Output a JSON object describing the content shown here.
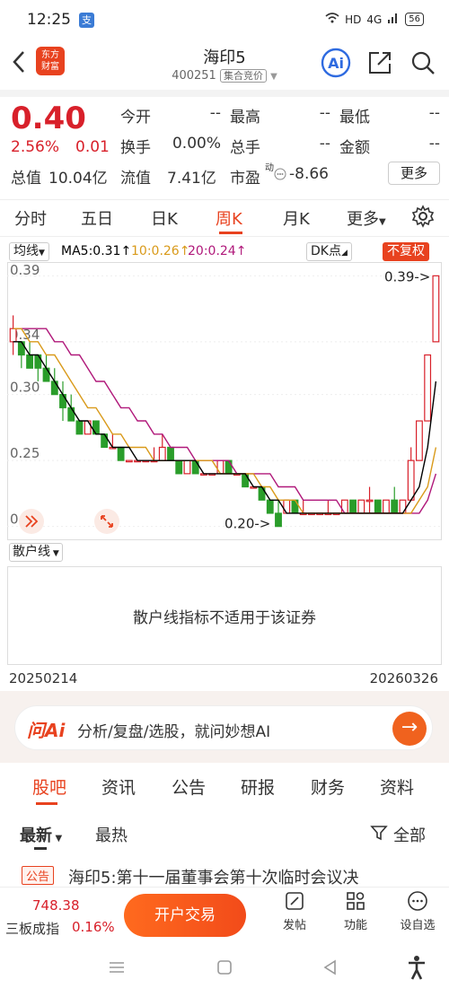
{
  "status": {
    "time": "12:25",
    "app_badge": "支",
    "network": "HD",
    "signal": "4G",
    "battery": "56"
  },
  "header": {
    "logo_text": "东方\n财富",
    "title": "海印5",
    "code": "400251",
    "market_tag": "集合竞价"
  },
  "quote": {
    "price": "0.40",
    "pct": "2.56%",
    "chg": "0.01",
    "fields": [
      {
        "label": "今开",
        "value": "--"
      },
      {
        "label": "最高",
        "value": "--"
      },
      {
        "label": "最低",
        "value": "--"
      },
      {
        "label": "换手",
        "value": "0.00%"
      },
      {
        "label": "总手",
        "value": "--"
      },
      {
        "label": "金额",
        "value": "--"
      }
    ],
    "total_label": "总值",
    "total_value": "10.04亿",
    "float_label": "流值",
    "float_value": "7.41亿",
    "pe_label": "市盈",
    "pe_sup": "动",
    "pe_value": "-8.66",
    "more_label": "更多"
  },
  "tabs": [
    "分时",
    "五日",
    "日K",
    "周K",
    "月K",
    "更多"
  ],
  "active_tab": "周K",
  "ma": {
    "type_label": "均线",
    "ma5": "MA5:0.31↑",
    "ma10": "10:0.26↑",
    "ma20": "20:0.24↑",
    "dk_label": "DK点",
    "adj_label": "不复权"
  },
  "colors": {
    "accent": "#e8421f",
    "up": "#d8202a",
    "down": "#2a9d2a",
    "ma5": "#000000",
    "ma10": "#d99a1a",
    "ma20": "#b0187a"
  },
  "chart_data": {
    "type": "candlestick",
    "y_ticks": [
      "0.39",
      "0.34",
      "0.30",
      "0.25",
      "0.20"
    ],
    "ylim": [
      0.195,
      0.395
    ],
    "max_label": "0.39->",
    "min_label": "0.20->",
    "start_date": "20250214",
    "end_date": "20260326",
    "candles": [
      [
        0.34,
        0.36,
        0.33,
        0.35
      ],
      [
        0.34,
        0.34,
        0.32,
        0.33
      ],
      [
        0.33,
        0.34,
        0.32,
        0.32
      ],
      [
        0.33,
        0.33,
        0.31,
        0.32
      ],
      [
        0.32,
        0.33,
        0.31,
        0.31
      ],
      [
        0.31,
        0.32,
        0.3,
        0.3
      ],
      [
        0.3,
        0.31,
        0.28,
        0.29
      ],
      [
        0.29,
        0.3,
        0.28,
        0.28
      ],
      [
        0.28,
        0.28,
        0.27,
        0.27
      ],
      [
        0.27,
        0.28,
        0.27,
        0.28
      ],
      [
        0.28,
        0.28,
        0.27,
        0.27
      ],
      [
        0.27,
        0.27,
        0.26,
        0.26
      ],
      [
        0.26,
        0.27,
        0.26,
        0.26
      ],
      [
        0.26,
        0.26,
        0.25,
        0.25
      ],
      [
        0.25,
        0.25,
        0.25,
        0.25
      ],
      [
        0.25,
        0.25,
        0.25,
        0.25
      ],
      [
        0.25,
        0.25,
        0.25,
        0.25
      ],
      [
        0.25,
        0.26,
        0.25,
        0.25
      ],
      [
        0.25,
        0.27,
        0.25,
        0.26
      ],
      [
        0.26,
        0.26,
        0.25,
        0.25
      ],
      [
        0.25,
        0.25,
        0.24,
        0.24
      ],
      [
        0.24,
        0.25,
        0.24,
        0.25
      ],
      [
        0.25,
        0.25,
        0.24,
        0.24
      ],
      [
        0.24,
        0.24,
        0.24,
        0.24
      ],
      [
        0.24,
        0.24,
        0.24,
        0.24
      ],
      [
        0.24,
        0.25,
        0.24,
        0.25
      ],
      [
        0.25,
        0.25,
        0.24,
        0.24
      ],
      [
        0.24,
        0.24,
        0.24,
        0.24
      ],
      [
        0.24,
        0.24,
        0.23,
        0.23
      ],
      [
        0.23,
        0.23,
        0.23,
        0.23
      ],
      [
        0.23,
        0.23,
        0.22,
        0.22
      ],
      [
        0.22,
        0.22,
        0.21,
        0.21
      ],
      [
        0.21,
        0.22,
        0.2,
        0.2
      ],
      [
        0.21,
        0.22,
        0.21,
        0.22
      ],
      [
        0.22,
        0.22,
        0.21,
        0.21
      ],
      [
        0.21,
        0.22,
        0.21,
        0.21
      ],
      [
        0.21,
        0.21,
        0.21,
        0.21
      ],
      [
        0.21,
        0.21,
        0.21,
        0.21
      ],
      [
        0.21,
        0.22,
        0.21,
        0.21
      ],
      [
        0.21,
        0.21,
        0.21,
        0.21
      ],
      [
        0.21,
        0.22,
        0.21,
        0.22
      ],
      [
        0.22,
        0.22,
        0.21,
        0.21
      ],
      [
        0.21,
        0.22,
        0.21,
        0.22
      ],
      [
        0.22,
        0.23,
        0.21,
        0.22
      ],
      [
        0.22,
        0.22,
        0.21,
        0.21
      ],
      [
        0.21,
        0.22,
        0.21,
        0.22
      ],
      [
        0.22,
        0.23,
        0.21,
        0.21
      ],
      [
        0.21,
        0.22,
        0.21,
        0.22
      ],
      [
        0.22,
        0.26,
        0.22,
        0.25
      ],
      [
        0.25,
        0.28,
        0.25,
        0.28
      ],
      [
        0.28,
        0.33,
        0.28,
        0.33
      ],
      [
        0.34,
        0.39,
        0.34,
        0.39
      ]
    ],
    "ma5": [
      0.34,
      0.34,
      0.33,
      0.33,
      0.32,
      0.31,
      0.3,
      0.29,
      0.28,
      0.28,
      0.27,
      0.27,
      0.26,
      0.26,
      0.26,
      0.25,
      0.25,
      0.25,
      0.25,
      0.25,
      0.25,
      0.25,
      0.25,
      0.24,
      0.24,
      0.24,
      0.24,
      0.24,
      0.24,
      0.23,
      0.23,
      0.22,
      0.22,
      0.21,
      0.21,
      0.21,
      0.21,
      0.21,
      0.21,
      0.21,
      0.21,
      0.21,
      0.21,
      0.21,
      0.21,
      0.21,
      0.21,
      0.21,
      0.22,
      0.23,
      0.26,
      0.31
    ],
    "ma10": [
      0.35,
      0.35,
      0.34,
      0.34,
      0.33,
      0.33,
      0.32,
      0.31,
      0.3,
      0.29,
      0.29,
      0.28,
      0.27,
      0.27,
      0.26,
      0.26,
      0.26,
      0.25,
      0.25,
      0.25,
      0.25,
      0.25,
      0.25,
      0.25,
      0.25,
      0.24,
      0.24,
      0.24,
      0.24,
      0.24,
      0.23,
      0.23,
      0.22,
      0.22,
      0.22,
      0.21,
      0.21,
      0.21,
      0.21,
      0.21,
      0.21,
      0.21,
      0.21,
      0.21,
      0.21,
      0.21,
      0.21,
      0.21,
      0.21,
      0.22,
      0.23,
      0.26
    ],
    "ma20": [
      0.35,
      0.35,
      0.35,
      0.35,
      0.35,
      0.34,
      0.34,
      0.33,
      0.33,
      0.32,
      0.31,
      0.31,
      0.3,
      0.29,
      0.29,
      0.28,
      0.28,
      0.27,
      0.27,
      0.26,
      0.26,
      0.26,
      0.25,
      0.25,
      0.25,
      0.25,
      0.25,
      0.24,
      0.24,
      0.24,
      0.24,
      0.24,
      0.23,
      0.23,
      0.23,
      0.22,
      0.22,
      0.22,
      0.22,
      0.22,
      0.21,
      0.21,
      0.21,
      0.21,
      0.21,
      0.21,
      0.21,
      0.21,
      0.21,
      0.21,
      0.22,
      0.24
    ]
  },
  "indicator": {
    "label": "散户线",
    "message": "散户线指标不适用于该证券"
  },
  "ai": {
    "logo": "问Ai",
    "text": "分析/复盘/选股，就问妙想AI",
    "go": "→"
  },
  "bottom_tabs": [
    "股吧",
    "资讯",
    "公告",
    "研报",
    "财务",
    "资料"
  ],
  "sub_tabs": {
    "latest": "最新",
    "hot": "最热",
    "filter": "全部"
  },
  "announcement": {
    "badge": "公告",
    "text": "海印5:第十一届董事会第十次临时会议决"
  },
  "index": {
    "value": "748.38",
    "name": "三板成指",
    "pct": "0.16%"
  },
  "actions": {
    "trade": "开户交易",
    "post": "发帖",
    "func": "功能",
    "watch": "设自选"
  }
}
